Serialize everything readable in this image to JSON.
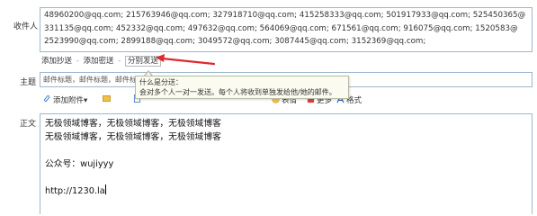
{
  "labels": {
    "recipients": "收件人",
    "subject": "主题",
    "body": "正文"
  },
  "recipients": {
    "lines": [
      "48960200@qq.com;  215763946@qq.com;  327918710@qq.com;  415258333@qq.com;  501917933@qq.com;  525450365@",
      "331135@qq.com;  452332@qq.com;  497632@qq.com;  564069@qq.com;  671561@qq.com;  916075@qq.com;  1520583@",
      "2523990@qq.com;  2899188@qq.com;  3049572@qq.com;  3087445@qq.com;  3152369@qq.com;"
    ]
  },
  "links": {
    "add_cc": "添加抄送",
    "add_bcc": "添加密送",
    "split_send": "分别发送",
    "sep": "-"
  },
  "subject": {
    "value": "邮件标题，邮件标题，邮件标题，"
  },
  "tooltip": {
    "title": "什么是分送：",
    "text": "会对多个人一对一发送。每个人将收到单独发给他/她的邮件。"
  },
  "toolbar": {
    "attach": "添加附件",
    "attach_arrow": "▾",
    "photo": "照片",
    "doc": "文档",
    "screenshot": "截屏",
    "emoji": "表情",
    "more": "更多",
    "format": "格式"
  },
  "body": {
    "lines": [
      "无极领域博客，无极领域博客，无极领域博客",
      "无极领域博客，无极领域博客，无极领域博客",
      "",
      "公众号：wujiyyy",
      "",
      "http://1230.la"
    ]
  },
  "colors": {
    "annotation_arrow": "#e0282e",
    "border": "#9fb6cc"
  },
  "icons": [
    "attach-icon",
    "photo-icon",
    "doc-icon",
    "screenshot-icon",
    "emoji-icon",
    "more-icon",
    "format-icon"
  ]
}
